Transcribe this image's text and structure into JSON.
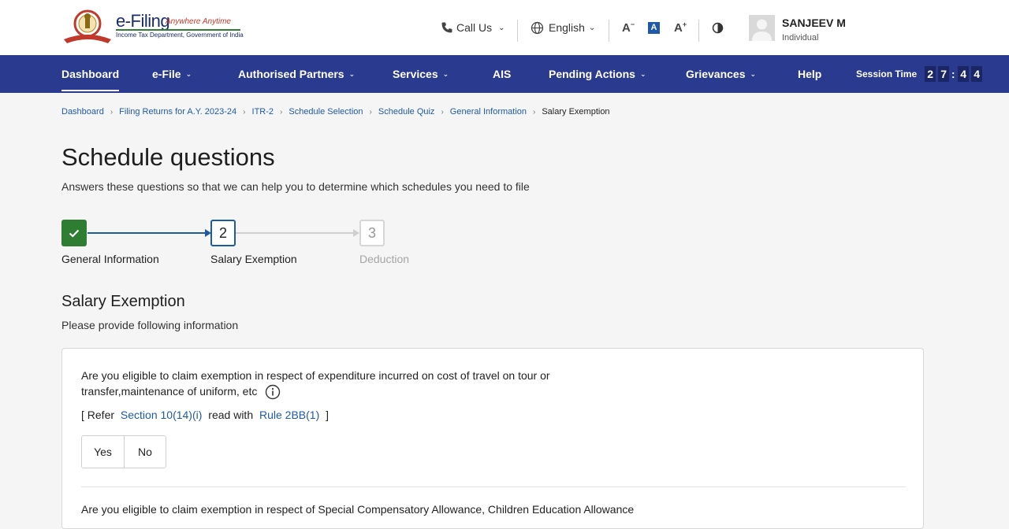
{
  "brand": {
    "title": "e-Filing",
    "tagline": "Anywhere Anytime",
    "subtitle": "Income Tax Department, Government of India",
    "emblem_icon": "national-emblem-logo"
  },
  "topbar": {
    "call_us": "Call Us",
    "language": "English",
    "user_name": "SANJEEV M",
    "user_role": "Individual"
  },
  "nav": {
    "items": [
      {
        "label": "Dashboard",
        "active": true,
        "dropdown": false
      },
      {
        "label": "e-File",
        "active": false,
        "dropdown": true
      },
      {
        "label": "Authorised Partners",
        "active": false,
        "dropdown": true
      },
      {
        "label": "Services",
        "active": false,
        "dropdown": true
      },
      {
        "label": "AIS",
        "active": false,
        "dropdown": false
      },
      {
        "label": "Pending Actions",
        "active": false,
        "dropdown": true
      },
      {
        "label": "Grievances",
        "active": false,
        "dropdown": true
      },
      {
        "label": "Help",
        "active": false,
        "dropdown": false
      }
    ],
    "session_label": "Session Time",
    "session_digits": [
      "2",
      "7",
      "4",
      "4"
    ]
  },
  "breadcrumb": [
    "Dashboard",
    "Filing Returns for A.Y. 2023-24",
    "ITR-2",
    "Schedule Selection",
    "Schedule Quiz",
    "General Information",
    "Salary Exemption"
  ],
  "page": {
    "title": "Schedule questions",
    "subtitle": "Answers these questions so that we can help you to determine which schedules you need to file"
  },
  "stepper": [
    {
      "number": "",
      "label": "General Information",
      "state": "done"
    },
    {
      "number": "2",
      "label": "Salary Exemption",
      "state": "current"
    },
    {
      "number": "3",
      "label": "Deduction",
      "state": "todo"
    }
  ],
  "section": {
    "title": "Salary Exemption",
    "subtitle": "Please provide following information"
  },
  "question1": {
    "text": "Are you eligible to claim exemption in respect of expenditure incurred on cost of travel on tour or transfer,maintenance of uniform, etc",
    "refer_open": "[ Refer",
    "refer_link1": "Section 10(14)(i)",
    "refer_mid": "read with",
    "refer_link2": "Rule 2BB(1)",
    "refer_close": "]",
    "yes_label": "Yes",
    "no_label": "No"
  },
  "question2": {
    "text": "Are you eligible to claim exemption in respect of Special Compensatory Allowance, Children Education Allowance"
  },
  "colors": {
    "nav_bg": "#2a3a8f",
    "link": "#1e5aa8",
    "step_done": "#2e7d32"
  }
}
